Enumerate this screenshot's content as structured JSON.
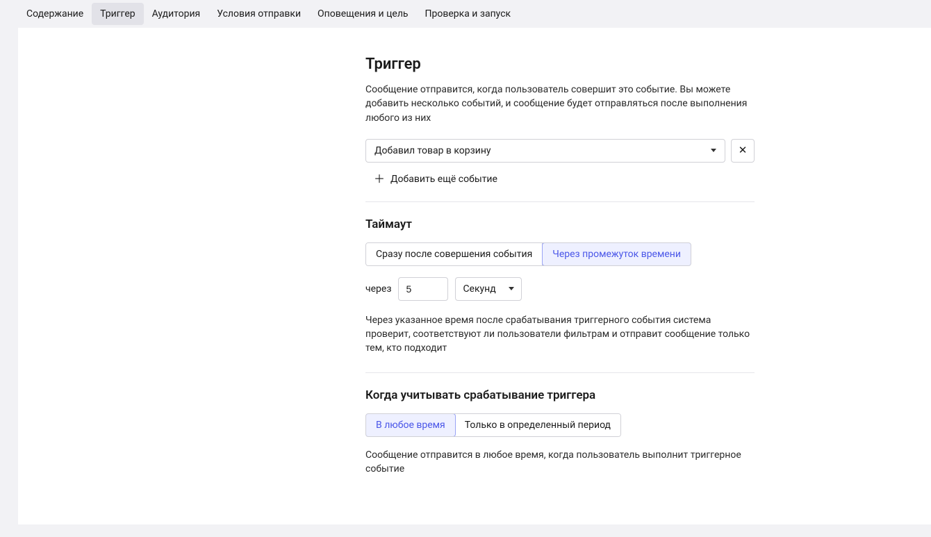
{
  "tabs": [
    {
      "label": "Содержание"
    },
    {
      "label": "Триггер"
    },
    {
      "label": "Аудитория"
    },
    {
      "label": "Условия отправки"
    },
    {
      "label": "Оповещения и цель"
    },
    {
      "label": "Проверка и запуск"
    }
  ],
  "trigger": {
    "title": "Триггер",
    "description": "Сообщение отправится, когда пользователь совершит это событие. Вы можете добавить несколько событий, и сообщение будет отправляться после выполнения любого из них",
    "event_select": "Добавил товар в корзину",
    "add_event": "Добавить ещё событие"
  },
  "timeout": {
    "title": "Таймаут",
    "option_immediate": "Сразу после совершения события",
    "option_delay": "Через промежуток времени",
    "after_label": "через",
    "value": "5",
    "unit": "Секунд",
    "help": "Через указанное время после срабатывания триггерного события система проверит, соответствуют ли пользователи фильтрам и отправит сообщение только тем, кто подходит"
  },
  "when": {
    "title": "Когда учитывать срабатывание триггера",
    "option_any": "В любое время",
    "option_period": "Только в определенный период",
    "help": "Сообщение отправится в любое время, когда пользователь выполнит триггерное событие"
  }
}
